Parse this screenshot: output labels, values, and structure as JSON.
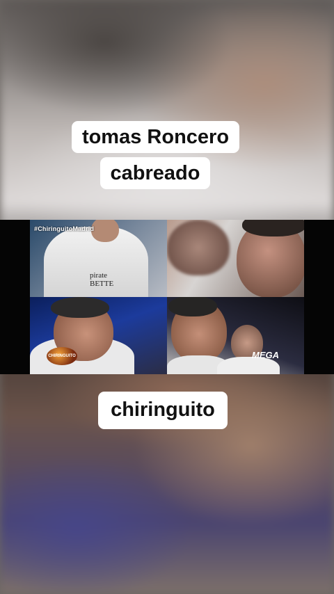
{
  "captions": {
    "line1": "tomas Roncero",
    "line2": "cabreado",
    "bottom": "chiringuito"
  },
  "video": {
    "hashtag": "#ChiringuitoMadrid",
    "logo_text": "CHIRINGUITO",
    "channel": "MEGA",
    "shirt_line1": "pirate",
    "shirt_line2": "BETTE"
  }
}
